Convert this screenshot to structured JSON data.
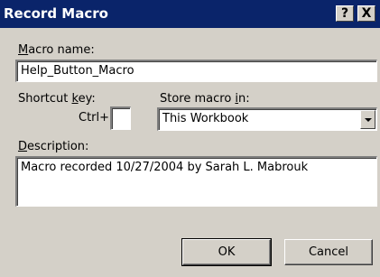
{
  "window": {
    "title": "Record Macro",
    "help_button": "?",
    "close_button": "X"
  },
  "macro_name": {
    "label_accesskey": "M",
    "label_rest": "acro name:",
    "value": "Help_Button_Macro"
  },
  "shortcut": {
    "label_pre": "Shortcut ",
    "label_accesskey": "k",
    "label_post": "ey:",
    "ctrl_prefix": "Ctrl+",
    "value": ""
  },
  "store": {
    "label_pre": "Store macro ",
    "label_accesskey": "i",
    "label_post": "n:",
    "selected": "This Workbook"
  },
  "description": {
    "label_accesskey": "D",
    "label_rest": "escription:",
    "value": "Macro recorded 10/27/2004 by Sarah L. Mabrouk"
  },
  "buttons": {
    "ok": "OK",
    "cancel": "Cancel"
  }
}
